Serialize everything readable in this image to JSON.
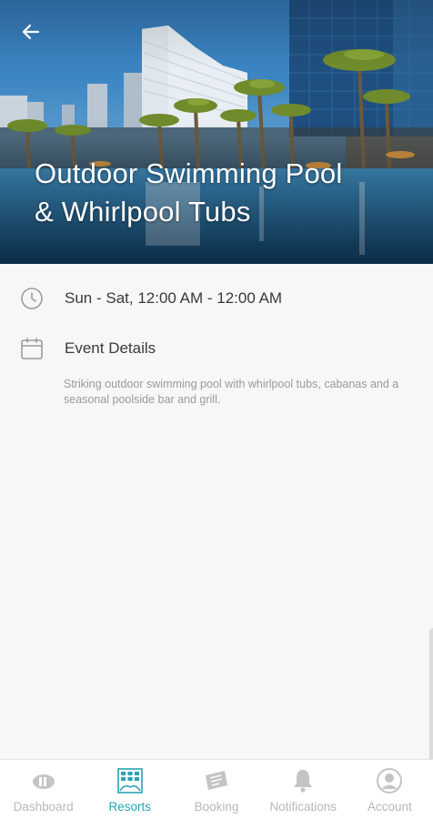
{
  "hero": {
    "title_line1": "Outdoor Swimming Pool",
    "title_line2": "& Whirlpool Tubs",
    "back_icon": "back-arrow-icon"
  },
  "event": {
    "hours": "Sun - Sat, 12:00 AM - 12:00 AM",
    "details_heading": "Event Details",
    "description": "Striking outdoor swimming pool with whirlpool tubs, cabanas and a seasonal poolside bar and grill."
  },
  "nav": {
    "active": "Resorts",
    "accent_color": "#2aa3b3",
    "inactive_color": "#b8b8b8",
    "items": [
      {
        "label": "Dashboard",
        "icon": "dashboard-icon"
      },
      {
        "label": "Resorts",
        "icon": "resorts-icon"
      },
      {
        "label": "Booking",
        "icon": "booking-icon"
      },
      {
        "label": "Notifications",
        "icon": "bell-icon"
      },
      {
        "label": "Account",
        "icon": "account-icon"
      }
    ]
  }
}
